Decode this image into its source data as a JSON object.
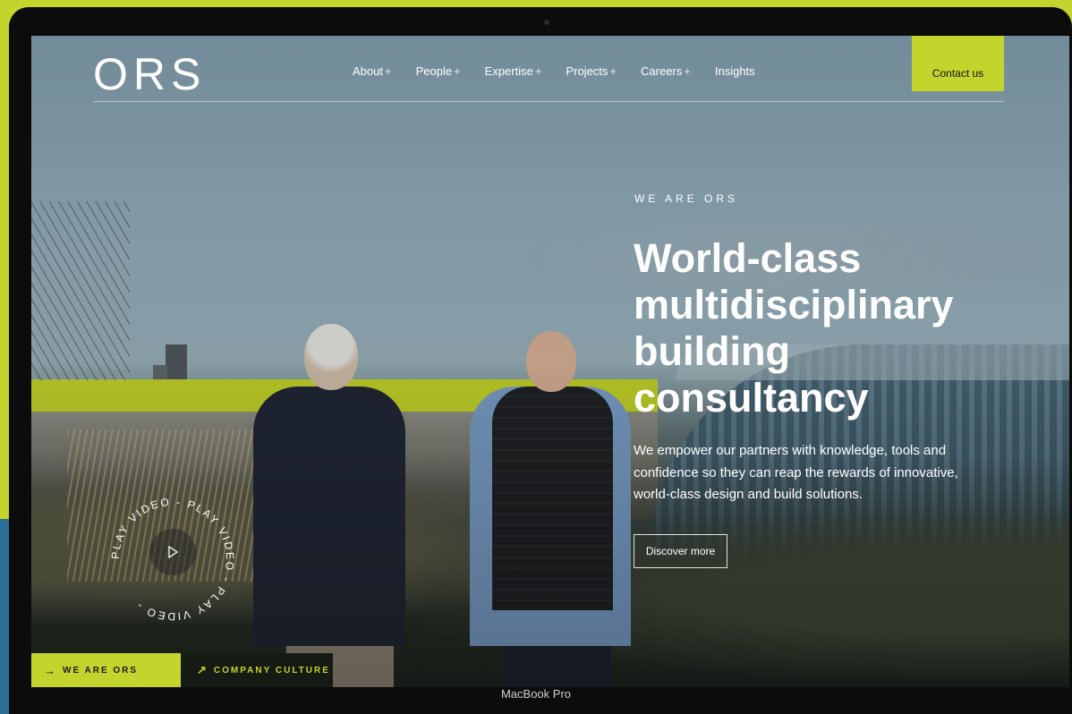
{
  "device_label": "MacBook Pro",
  "header": {
    "logo": "ORS",
    "nav": [
      {
        "label": "About",
        "suffix": "+"
      },
      {
        "label": "People",
        "suffix": "+"
      },
      {
        "label": "Expertise",
        "suffix": "+"
      },
      {
        "label": "Projects",
        "suffix": "+"
      },
      {
        "label": "Careers",
        "suffix": "+"
      },
      {
        "label": "Insights",
        "suffix": ""
      }
    ],
    "contact_label": "Contact us"
  },
  "hero": {
    "eyebrow": "WE ARE ORS",
    "headline": "World-class multidisciplinary building consultancy",
    "body": "We empower our partners with knowledge, tools and confidence so they can reap the rewards of innovative, world-class design and build solutions.",
    "cta_label": "Discover more"
  },
  "play_video": {
    "ring_text": "PLAY VIDEO - PLAY VIDEO - PLAY VIDEO - "
  },
  "bottom_tabs": [
    {
      "label": "WE ARE ORS",
      "icon": "arrow-right-icon",
      "glyph": "→"
    },
    {
      "label": "COMPANY CULTURE",
      "icon": "arrow-up-right-icon",
      "glyph": "↗"
    }
  ],
  "colors": {
    "accent": "#c3d42c",
    "dark": "#161a14"
  }
}
